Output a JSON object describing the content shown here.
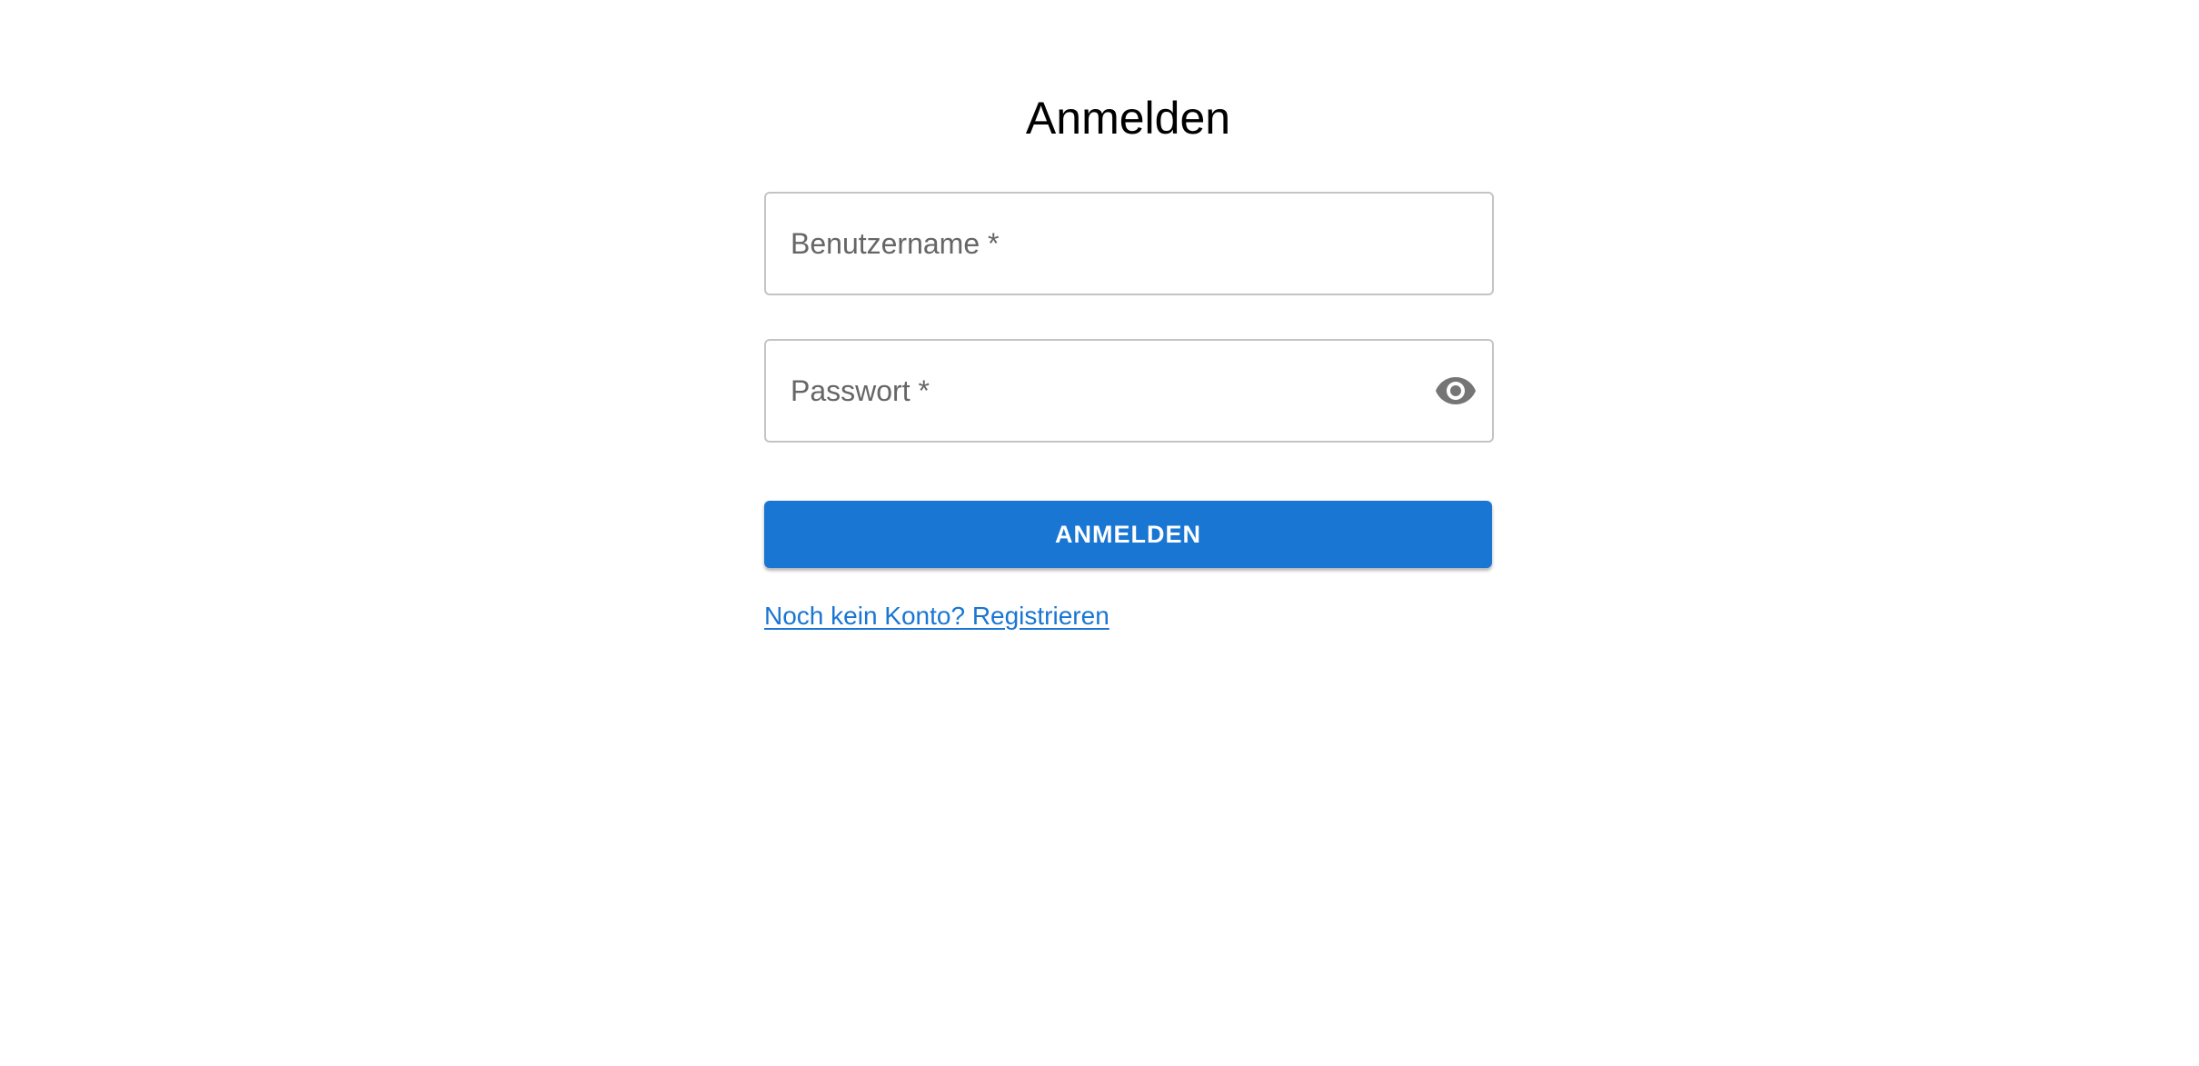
{
  "login": {
    "title": "Anmelden",
    "username": {
      "label": "Benutzername *",
      "value": ""
    },
    "password": {
      "label": "Passwort *",
      "value": "",
      "toggle_icon": "eye-icon"
    },
    "submit_label": "ANMELDEN",
    "register_link": "Noch kein Konto? Registrieren"
  },
  "colors": {
    "primary": "#1976d2",
    "border": "#c4c4c4",
    "label": "#666666",
    "icon": "#757575"
  }
}
